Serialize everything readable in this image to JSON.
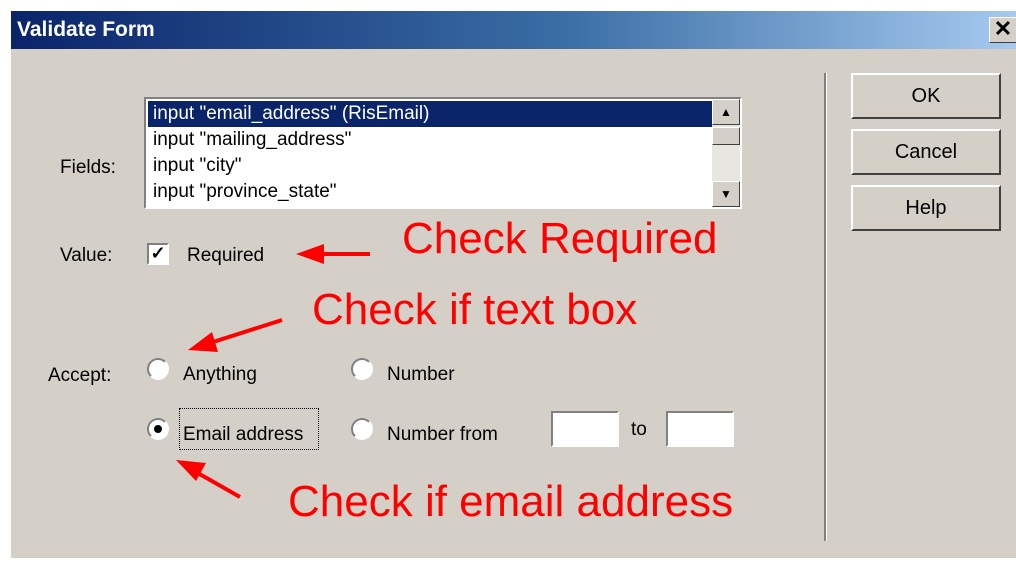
{
  "window": {
    "title": "Validate Form",
    "close_glyph": "✕"
  },
  "fields": {
    "label": "Fields:",
    "items": [
      "input \"email_address\" (RisEmail)",
      "input \"mailing_address\"",
      "input \"city\"",
      "input \"province_state\""
    ],
    "selected_index": 0
  },
  "value": {
    "label": "Value:",
    "required_label": "Required",
    "required_checked": true
  },
  "accept": {
    "label": "Accept:",
    "anything_label": "Anything",
    "number_label": "Number",
    "email_label": "Email address",
    "number_from_label": "Number from",
    "to_label": "to",
    "selected": "email",
    "from_value": "",
    "to_value": ""
  },
  "buttons": {
    "ok": "OK",
    "cancel": "Cancel",
    "help": "Help"
  },
  "annotations": {
    "required": "Check Required",
    "textbox": "Check if text box",
    "email": "Check if email address",
    "color": "#ff0000"
  },
  "icons": {
    "scroll_up": "up-arrow-icon",
    "scroll_down": "down-arrow-icon"
  }
}
